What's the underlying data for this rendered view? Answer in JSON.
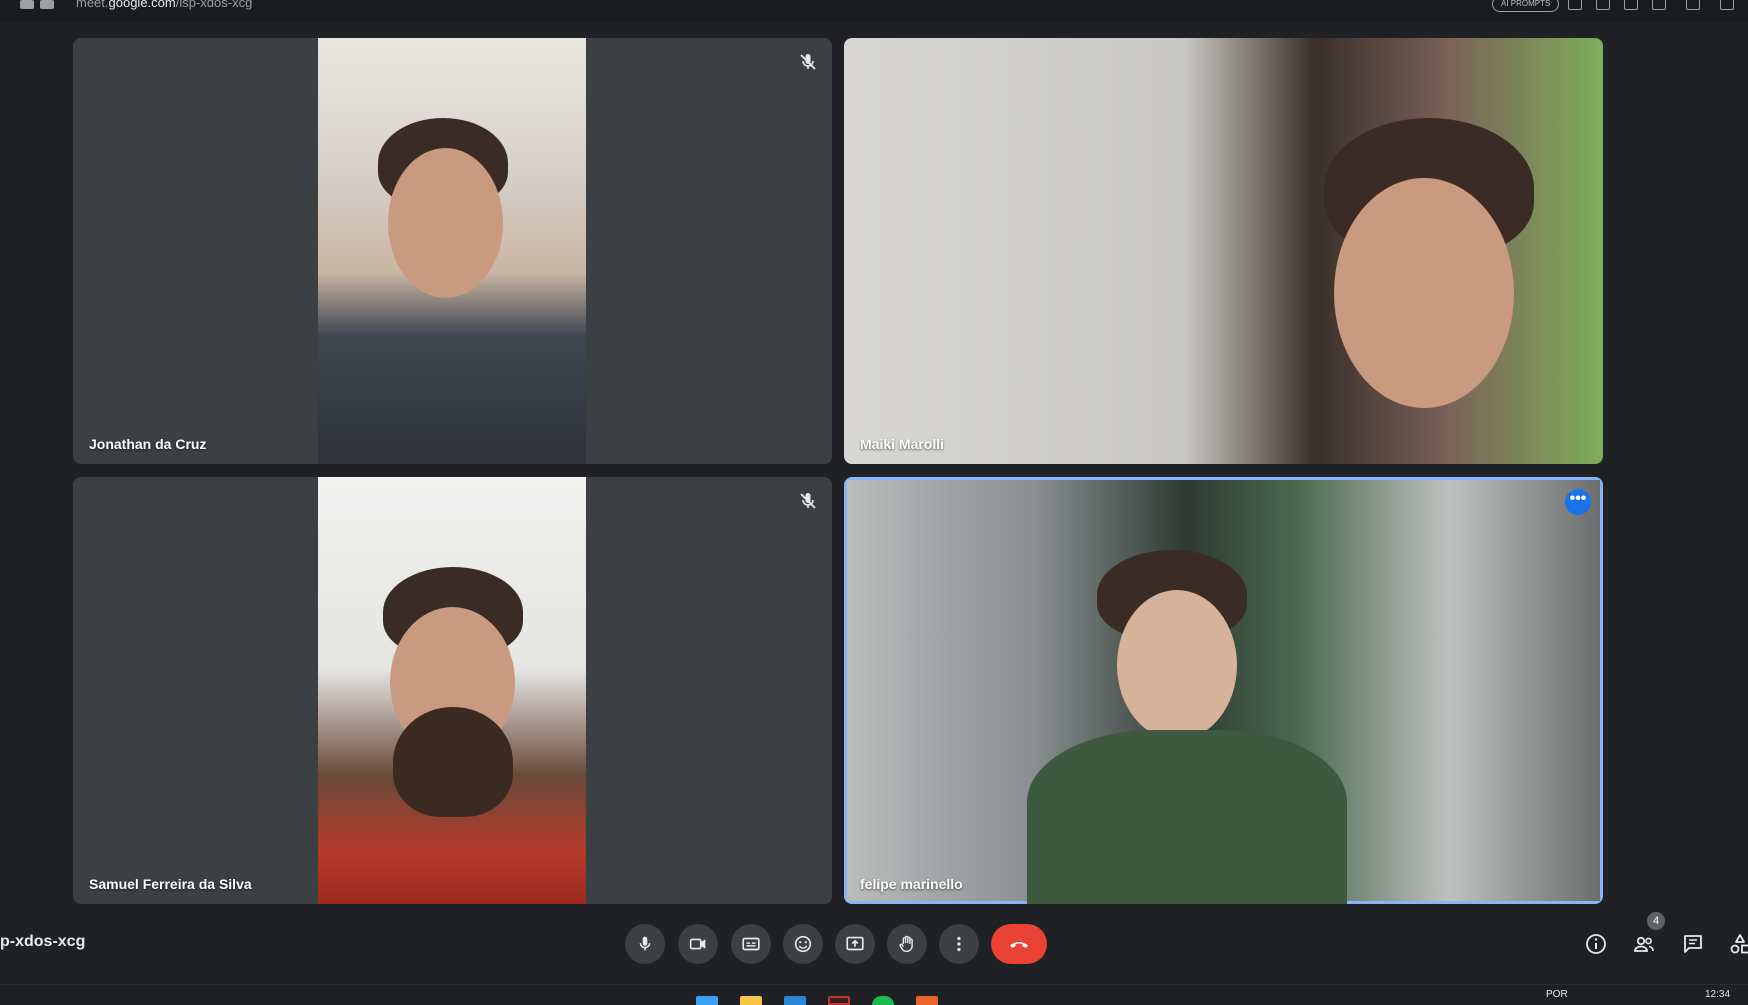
{
  "browser": {
    "url_prefix": "meet.",
    "url_domain": "google.com",
    "url_path": "/isp-xdos-xcg",
    "ai_prompts_label": "AI PROMPTS"
  },
  "participants": [
    {
      "name": "Jonathan da Cruz",
      "muted": true
    },
    {
      "name": "Maiki Marolli",
      "muted": false
    },
    {
      "name": "Samuel Ferreira da Silva",
      "muted": true
    },
    {
      "name": "felipe marinello",
      "muted": false,
      "active_speaker": true
    }
  ],
  "meeting": {
    "code_visible": "p-xdos-xcg",
    "participant_count": "4",
    "more_options_glyph": "•••"
  },
  "controls": [
    "mic-icon",
    "camera-icon",
    "captions-icon",
    "emoji-icon",
    "present-icon",
    "raise-hand-icon",
    "more-options-icon",
    "end-call-icon"
  ],
  "taskbar": {
    "language": "POR",
    "time": "12:34"
  },
  "colors": {
    "background": "#202124",
    "tile": "#3c4043",
    "end_call": "#ea4335",
    "active_border": "#8ab4f8",
    "accent": "#1a73e8"
  }
}
